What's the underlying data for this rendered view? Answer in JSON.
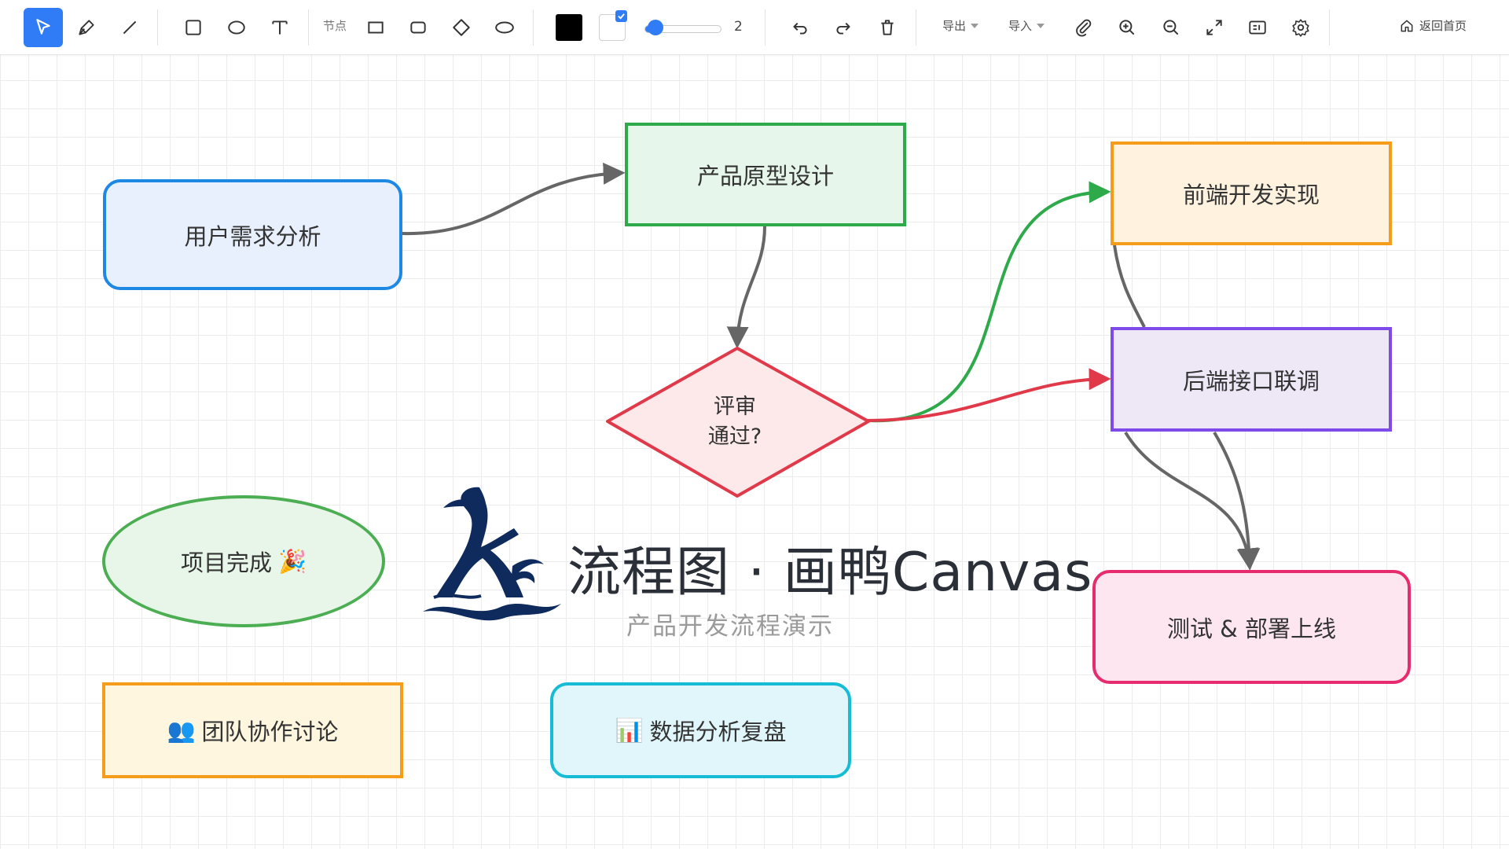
{
  "toolbar": {
    "tools": [
      {
        "name": "select",
        "icon": "pointer-icon",
        "active": true
      },
      {
        "name": "pen",
        "icon": "pen-icon"
      },
      {
        "name": "line",
        "icon": "line-icon"
      },
      {
        "name": "rect",
        "icon": "rectangle-icon"
      },
      {
        "name": "ellipse",
        "icon": "ellipse-icon"
      },
      {
        "name": "text",
        "icon": "text-icon"
      }
    ],
    "node_label": "节点",
    "node_shapes": [
      "rectangle-icon",
      "rounded-rectangle-icon",
      "diamond-icon",
      "ellipse-icon"
    ],
    "stroke_color": "#000000",
    "fill_color": "#ffffff",
    "fill_enabled": true,
    "stroke_width": "2",
    "stroke_width_fraction": 0.05,
    "actions": [
      "undo-icon",
      "redo-icon",
      "trash-icon"
    ],
    "export_label": "导出",
    "import_label": "导入",
    "view_actions": [
      "paperclip-icon",
      "zoom-in-icon",
      "zoom-out-icon",
      "fullscreen-icon",
      "panel-icon",
      "settings-icon"
    ],
    "home_label": "返回首页"
  },
  "nodes": {
    "requirements": {
      "label": "用户需求分析",
      "fill": "#e8f0fd",
      "stroke": "#1e88e5"
    },
    "prototype": {
      "label": "产品原型设计",
      "fill": "#e6f6ea",
      "stroke": "#2eaa4a"
    },
    "review": {
      "line1": "评审",
      "line2": "通过?",
      "fill": "#fde8ea",
      "stroke": "#e0394a"
    },
    "frontend": {
      "label": "前端开发实现",
      "fill": "#fff3e0",
      "stroke": "#f59c1a"
    },
    "backend": {
      "label": "后端接口联调",
      "fill": "#ede7f6",
      "stroke": "#7e4bea"
    },
    "deploy": {
      "label": "测试 & 部署上线",
      "fill": "#fde6ef",
      "stroke": "#e62c6e"
    },
    "done": {
      "label": "项目完成",
      "emoji": "🎉",
      "fill": "#e8f5e9",
      "stroke": "#4cae52"
    },
    "team": {
      "label": "团队协作讨论",
      "emoji": "👥",
      "fill": "#fff6e0",
      "stroke": "#f59c1a"
    },
    "data": {
      "label": "数据分析复盘",
      "emoji": "📊",
      "fill": "#e0f6fa",
      "stroke": "#16bcd6"
    }
  },
  "edge_colors": {
    "default": "#666666",
    "yes": "#2eaa4a",
    "no": "#e0394a"
  },
  "watermark": {
    "logo_text": "Kv",
    "title": "流程图 · 画鸭Canvas",
    "subtitle": "产品开发流程演示",
    "color": "#0f2a5c"
  }
}
